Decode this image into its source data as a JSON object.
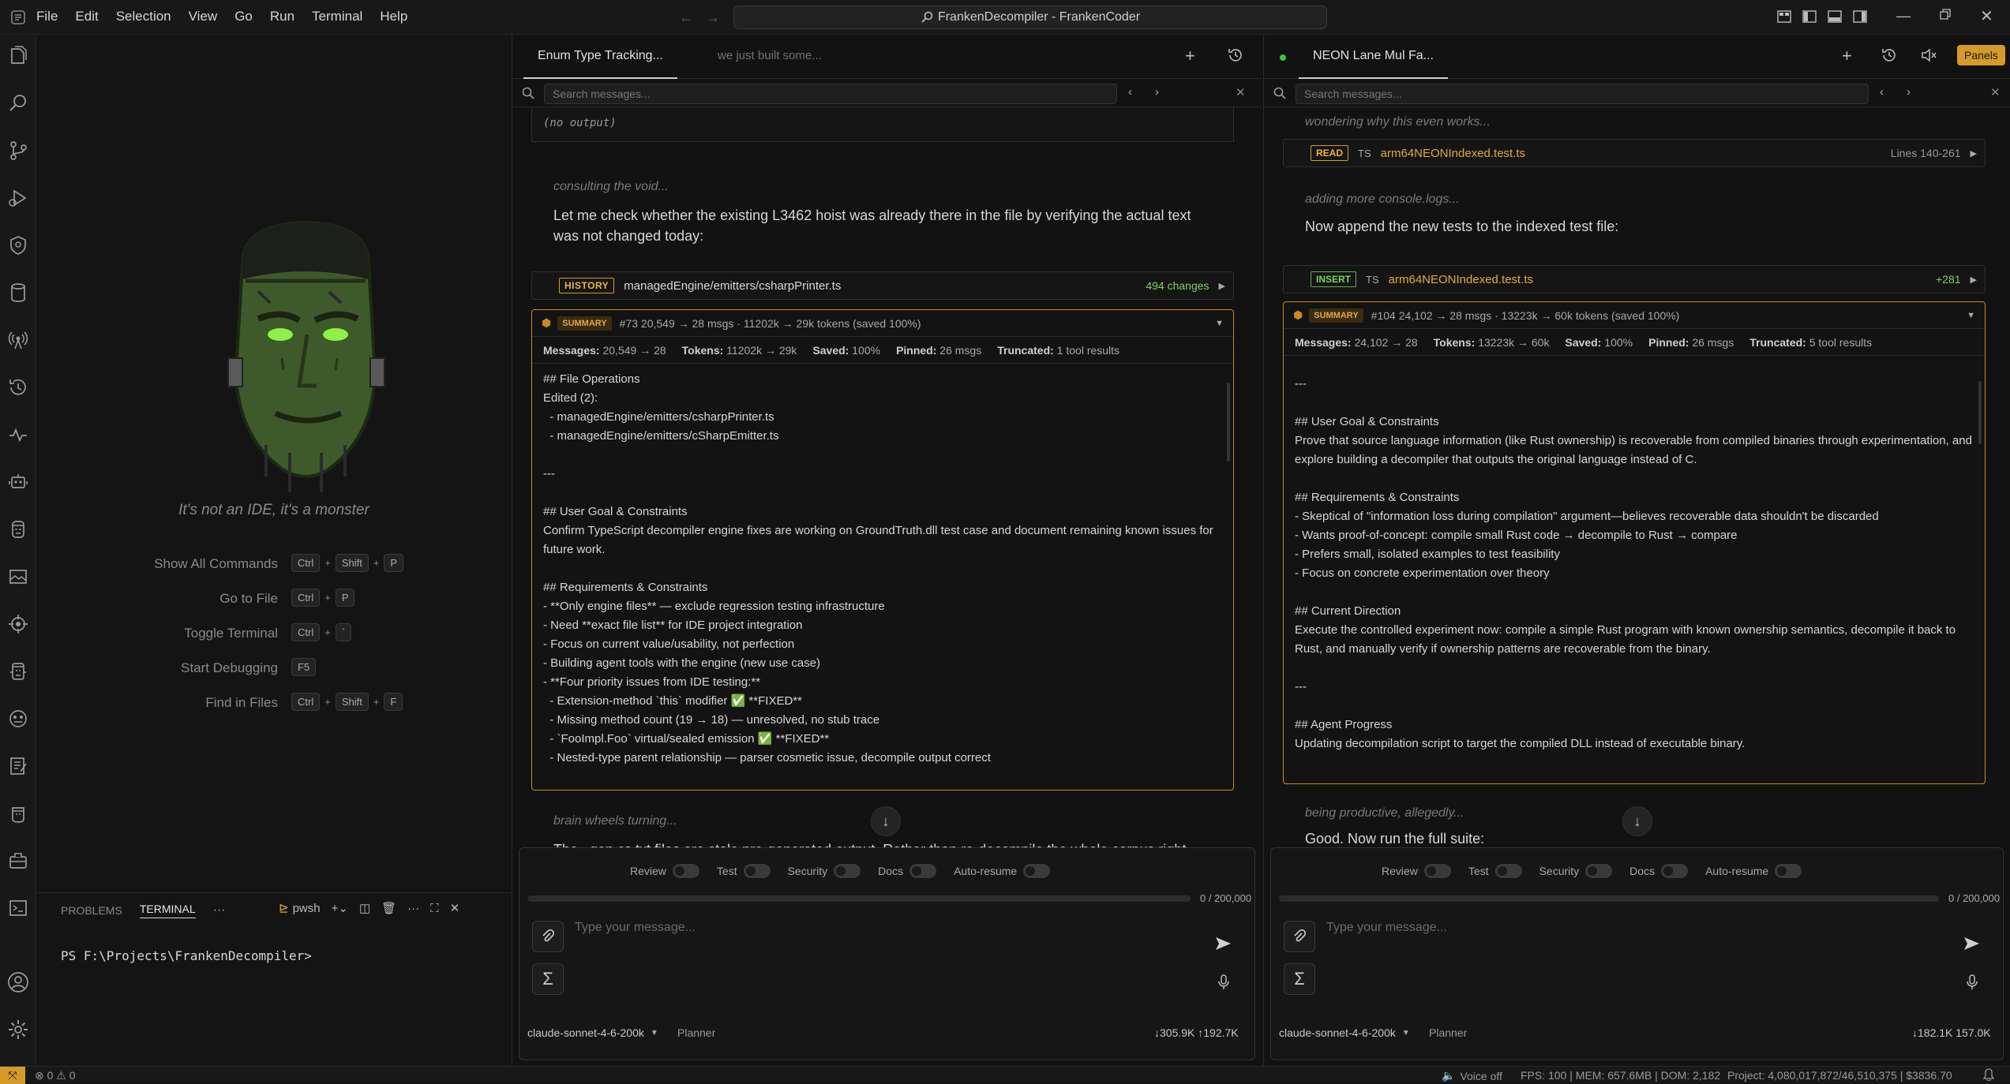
{
  "titlebar": {
    "menus": [
      "File",
      "Edit",
      "Selection",
      "View",
      "Go",
      "Run",
      "Terminal",
      "Help"
    ],
    "command_center": "FrankenDecompiler - FrankenCoder"
  },
  "welcome": {
    "tagline": "It's not an IDE, it's a monster",
    "shortcuts": [
      {
        "label": "Show All Commands",
        "keys": [
          "Ctrl",
          "Shift",
          "P"
        ]
      },
      {
        "label": "Go to File",
        "keys": [
          "Ctrl",
          "P"
        ]
      },
      {
        "label": "Toggle Terminal",
        "keys": [
          "Ctrl",
          "`"
        ]
      },
      {
        "label": "Start Debugging",
        "keys": [
          "F5"
        ]
      },
      {
        "label": "Find in Files",
        "keys": [
          "Ctrl",
          "Shift",
          "F"
        ]
      }
    ]
  },
  "terminal": {
    "tabs": [
      "PROBLEMS",
      "TERMINAL"
    ],
    "more": "···",
    "shell": "pwsh",
    "prompt": "PS F:\\Projects\\FrankenDecompiler>"
  },
  "chat_left": {
    "tab_active": "Enum Type Tracking...",
    "tab_inactive": "we just built some...",
    "search_placeholder": "Search messages...",
    "prev_output": "(no output)",
    "thinking1": "consulting the void...",
    "message1": "Let me check whether the existing L3462 hoist was already there in the file by verifying the actual text was not changed today:",
    "tool": {
      "tag": "HISTORY",
      "path": "managedEngine/emitters/csharpPrinter.ts",
      "meta": "494 changes"
    },
    "summary": {
      "badge": "SUMMARY",
      "header": "#73  20,549 → 28 msgs · 11202k → 29k tokens (saved 100%)",
      "stats": [
        {
          "k": "Messages:",
          "v": "20,549 → 28"
        },
        {
          "k": "Tokens:",
          "v": "11202k → 29k"
        },
        {
          "k": "Saved:",
          "v": "100%"
        },
        {
          "k": "Pinned:",
          "v": "26 msgs"
        },
        {
          "k": "Truncated:",
          "v": "1 tool results"
        }
      ],
      "body": "## File Operations\nEdited (2):\n  - managedEngine/emitters/csharpPrinter.ts\n  - managedEngine/emitters/cSharpEmitter.ts\n\n---\n\n## User Goal & Constraints\nConfirm TypeScript decompiler engine fixes are working on GroundTruth.dll test case and document remaining known issues for future work.\n\n## Requirements & Constraints\n- **Only engine files** — exclude regression testing infrastructure\n- Need **exact file list** for IDE project integration\n- Focus on current value/usability, not perfection\n- Building agent tools with the engine (new use case)\n- **Four priority issues from IDE testing:**\n  - Extension-method `this` modifier ✅ **FIXED**\n  - Missing method count (19 → 18) — unresolved, no stub trace\n  - `FooImpl.Foo` virtual/sealed emission ✅ **FIXED**\n  - Nested-type parent relationship — parser cosmetic issue, decompile output correct"
    },
    "thinking2": "brain wheels turning...",
    "message2": "The ..gen.cs.txt files are stale pre-generated output. Rather than re-decompile the whole corpus right",
    "toggles": [
      "Review",
      "Test",
      "Security",
      "Docs",
      "Auto-resume"
    ],
    "progress_label": "0 / 200,000",
    "progress": 0,
    "input_placeholder": "Type your message...",
    "model": "claude-sonnet-4-6-200k",
    "mode": "Planner",
    "tokens": "↓305.9K  ↑192.7K"
  },
  "chat_right": {
    "tab_active": "NEON Lane Mul Fa...",
    "panels_button": "Panels",
    "search_placeholder": "Search messages...",
    "thinking0": "wondering why this even works...",
    "tool_read": {
      "tag": "READ",
      "lang": "TS",
      "path": "arm64NEONIndexed.test.ts",
      "meta": "Lines 140-261"
    },
    "thinking1": "adding more console.logs...",
    "message1": "Now append the new tests to the indexed test file:",
    "tool_insert": {
      "tag": "INSERT",
      "lang": "TS",
      "path": "arm64NEONIndexed.test.ts",
      "meta": "+281"
    },
    "summary": {
      "badge": "SUMMARY",
      "header": "#104  24,102 → 28 msgs · 13223k → 60k tokens (saved 100%)",
      "stats": [
        {
          "k": "Messages:",
          "v": "24,102 → 28"
        },
        {
          "k": "Tokens:",
          "v": "13223k → 60k"
        },
        {
          "k": "Saved:",
          "v": "100%"
        },
        {
          "k": "Pinned:",
          "v": "26 msgs"
        },
        {
          "k": "Truncated:",
          "v": "5 tool results"
        }
      ],
      "body": "---\n\n## User Goal & Constraints\nProve that source language information (like Rust ownership) is recoverable from compiled binaries through experimentation, and explore building a decompiler that outputs the original language instead of C.\n\n## Requirements & Constraints\n- Skeptical of \"information loss during compilation\" argument—believes recoverable data shouldn't be discarded\n- Wants proof-of-concept: compile small Rust code → decompile to Rust → compare\n- Prefers small, isolated examples to test feasibility\n- Focus on concrete experimentation over theory\n\n## Current Direction\nExecute the controlled experiment now: compile a simple Rust program with known ownership semantics, decompile it back to Rust, and manually verify if ownership patterns are recoverable from the binary.\n\n---\n\n## Agent Progress\nUpdating decompilation script to target the compiled DLL instead of executable binary."
    },
    "thinking2": "being productive, allegedly...",
    "message2": "Good. Now run the full suite:",
    "toggles": [
      "Review",
      "Test",
      "Security",
      "Docs",
      "Auto-resume"
    ],
    "progress_label": "0 / 200,000",
    "progress": 0,
    "input_placeholder": "Type your message...",
    "model": "claude-sonnet-4-6-200k",
    "mode": "Planner",
    "tokens": "↓182.1K  157.0K"
  },
  "statusbar": {
    "problems": "⊗ 0 ⚠ 0",
    "voice": "Voice off",
    "perf": "FPS: 100 | MEM: 657.6MB | DOM: 2,182",
    "project": "Project: 4,080,017,872/46,510,375 | $3836.70"
  },
  "colors": {
    "accent": "#d49a2a",
    "bg": "#121212",
    "green": "#7fd060",
    "status_dot": "#3fbf4a"
  }
}
